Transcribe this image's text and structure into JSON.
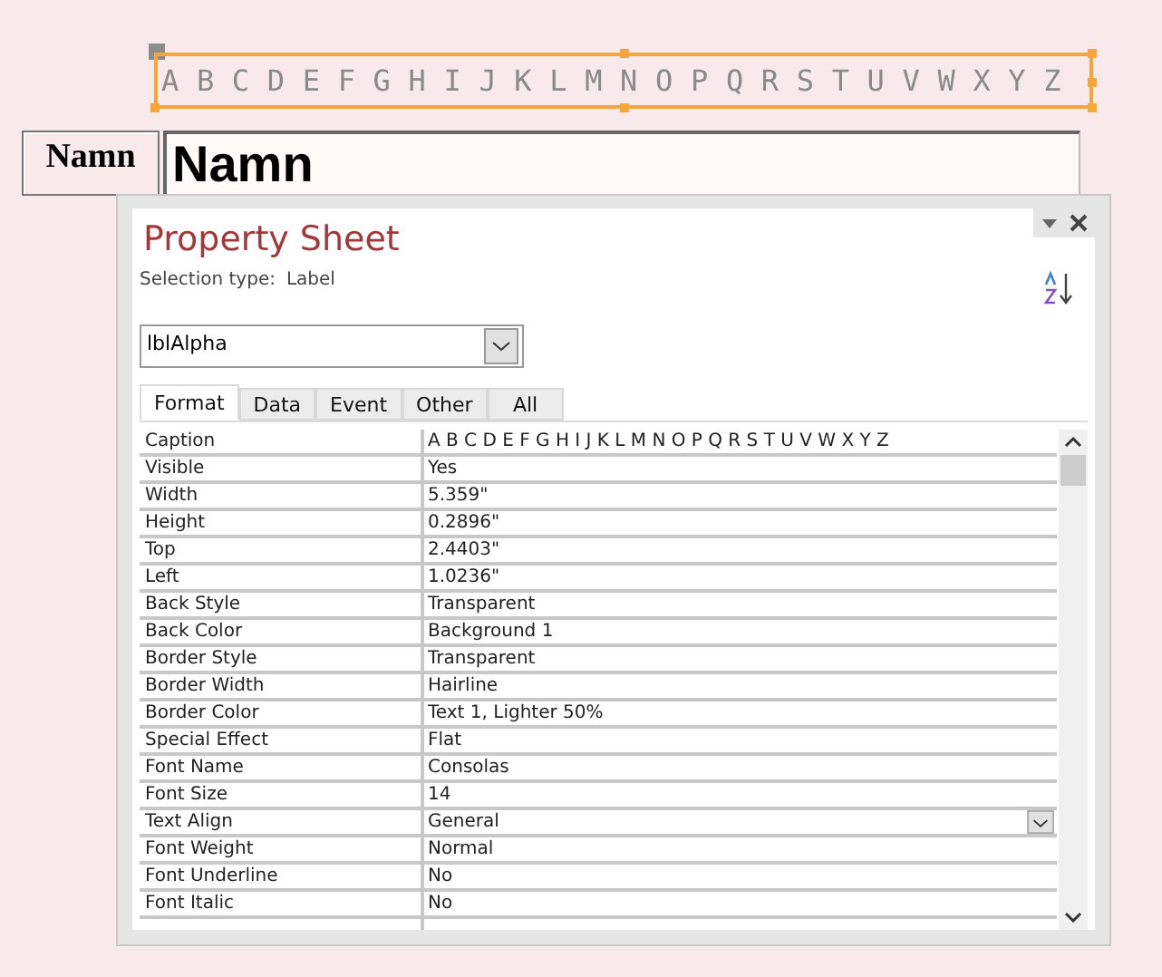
{
  "design_label": {
    "text": "A B C D E F G H I J K L M N O P Q R S T U V W X Y Z",
    "selected": true
  },
  "form_label": "Namn",
  "form_textbox": "Namn",
  "property_sheet": {
    "title": "Property Sheet",
    "selection_type_label": "Selection type:",
    "selection_type": "Label",
    "object_combo": "lblAlpha",
    "tabs": [
      {
        "label": "Format",
        "selected": true
      },
      {
        "label": "Data",
        "selected": false
      },
      {
        "label": "Event",
        "selected": false
      },
      {
        "label": "Other",
        "selected": false
      },
      {
        "label": "All",
        "selected": false
      }
    ],
    "rows": [
      {
        "name": "Caption",
        "value": "A B C D E F G H I J K L M N O P Q R S T U V W X Y Z",
        "dropdown": false
      },
      {
        "name": "Visible",
        "value": "Yes",
        "dropdown": false
      },
      {
        "name": "Width",
        "value": "5.359\"",
        "dropdown": false
      },
      {
        "name": "Height",
        "value": "0.2896\"",
        "dropdown": false
      },
      {
        "name": "Top",
        "value": "2.4403\"",
        "dropdown": false
      },
      {
        "name": "Left",
        "value": "1.0236\"",
        "dropdown": false
      },
      {
        "name": "Back Style",
        "value": "Transparent",
        "dropdown": false
      },
      {
        "name": "Back Color",
        "value": "Background 1",
        "dropdown": false
      },
      {
        "name": "Border Style",
        "value": "Transparent",
        "dropdown": false
      },
      {
        "name": "Border Width",
        "value": "Hairline",
        "dropdown": false
      },
      {
        "name": "Border Color",
        "value": "Text 1, Lighter 50%",
        "dropdown": false
      },
      {
        "name": "Special Effect",
        "value": "Flat",
        "dropdown": false
      },
      {
        "name": "Font Name",
        "value": "Consolas",
        "dropdown": false
      },
      {
        "name": "Font Size",
        "value": "14",
        "dropdown": false
      },
      {
        "name": "Text Align",
        "value": "General",
        "dropdown": true
      },
      {
        "name": "Font Weight",
        "value": "Normal",
        "dropdown": false
      },
      {
        "name": "Font Underline",
        "value": "No",
        "dropdown": false
      },
      {
        "name": "Font Italic",
        "value": "No",
        "dropdown": false
      }
    ]
  }
}
